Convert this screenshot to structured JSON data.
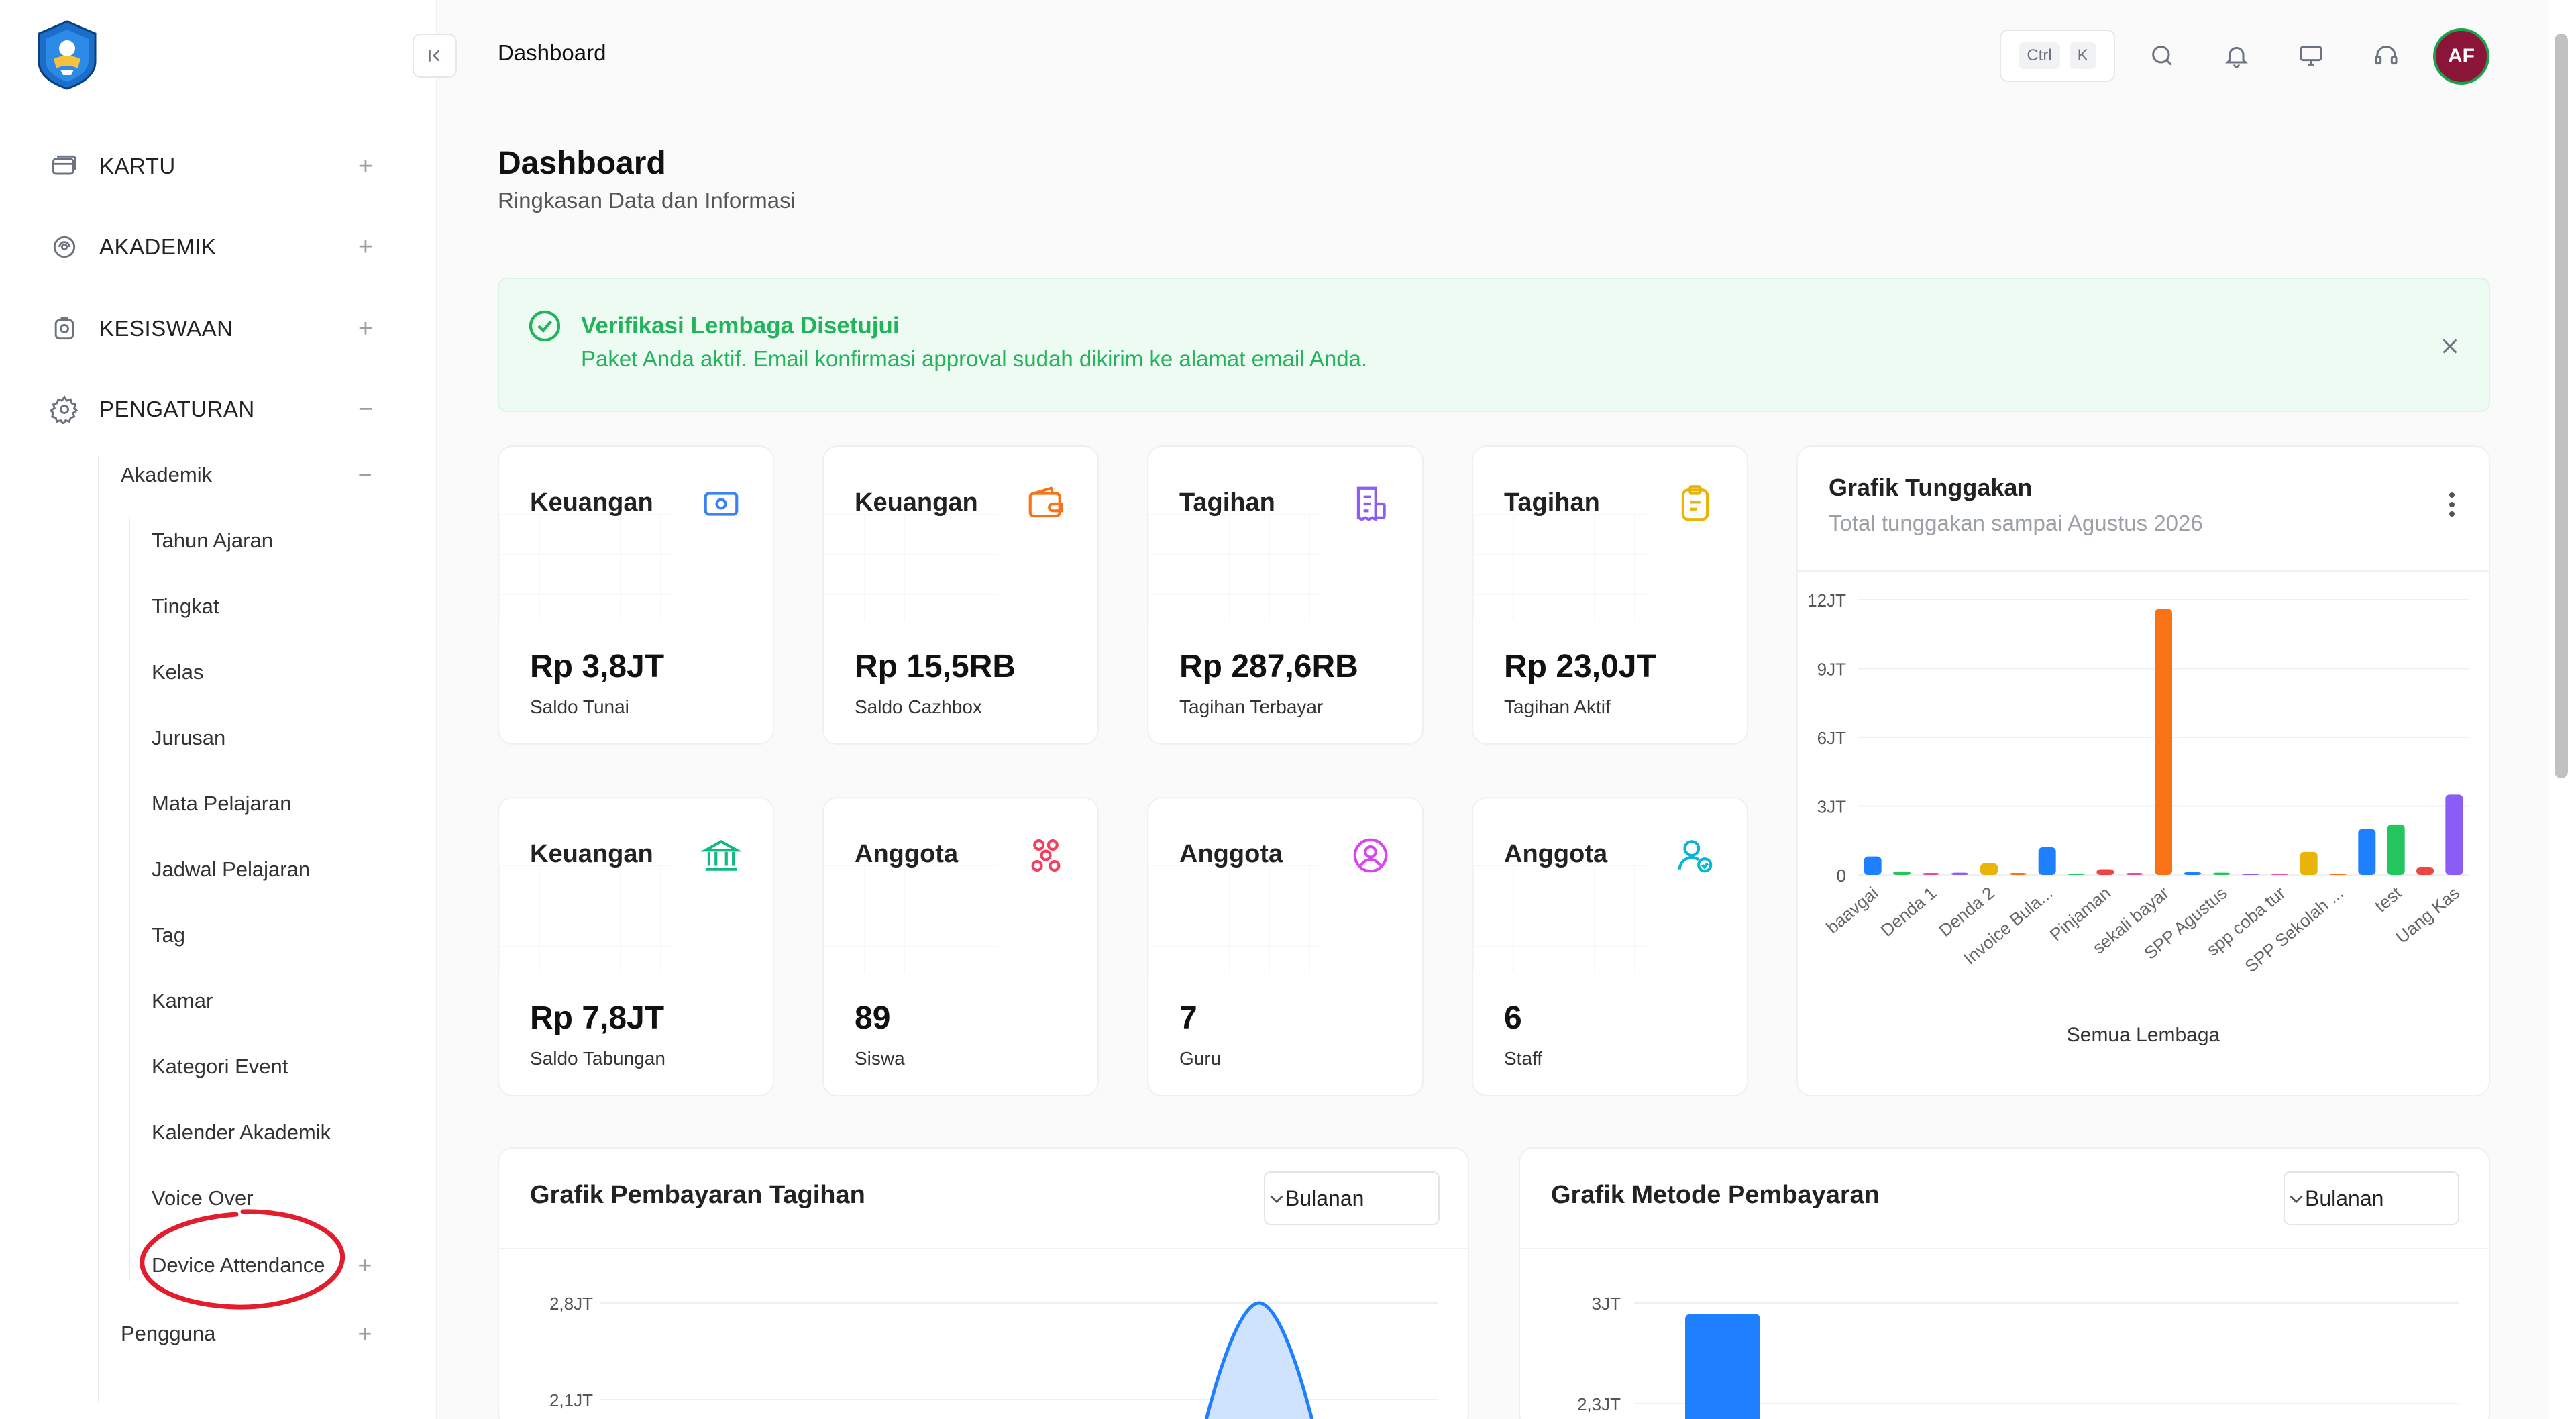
{
  "sidebar": {
    "items": [
      {
        "label": "KARTU",
        "icon": "card-icon",
        "toggle": "+"
      },
      {
        "label": "AKADEMIK",
        "icon": "academic-icon",
        "toggle": "+"
      },
      {
        "label": "KESISWAAN",
        "icon": "student-affairs-icon",
        "toggle": "+"
      },
      {
        "label": "PENGATURAN",
        "icon": "gear-icon",
        "toggle": "−"
      }
    ],
    "akademik": {
      "label": "Akademik",
      "toggle": "−"
    },
    "akademik_items": [
      "Tahun Ajaran",
      "Tingkat",
      "Kelas",
      "Jurusan",
      "Mata Pelajaran",
      "Jadwal Pelajaran",
      "Tag",
      "Kamar",
      "Kategori Event",
      "Kalender Akademik",
      "Voice Over",
      "Device Attendance"
    ],
    "device_attendance_toggle": "+",
    "pengguna": {
      "label": "Pengguna",
      "toggle": "+"
    }
  },
  "topbar": {
    "breadcrumb": "Dashboard",
    "shortcut_ctrl": "Ctrl",
    "shortcut_key": "K",
    "avatar_initials": "AF"
  },
  "page": {
    "title": "Dashboard",
    "subtitle": "Ringkasan Data dan Informasi"
  },
  "alert": {
    "title": "Verifikasi Lembaga Disetujui",
    "message": "Paket Anda aktif. Email konfirmasi approval sudah dikirim ke alamat email Anda."
  },
  "stats": [
    {
      "category": "Keuangan",
      "value": "Rp 3,8JT",
      "label": "Saldo Tunai",
      "icon": "money-icon",
      "color": "#3b82f6"
    },
    {
      "category": "Keuangan",
      "value": "Rp 15,5RB",
      "label": "Saldo Cazhbox",
      "icon": "wallet-icon",
      "color": "#f97316"
    },
    {
      "category": "Tagihan",
      "value": "Rp 287,6RB",
      "label": "Tagihan Terbayar",
      "icon": "receipt-icon",
      "color": "#8b5cf6"
    },
    {
      "category": "Tagihan",
      "value": "Rp 23,0JT",
      "label": "Tagihan Aktif",
      "icon": "clipboard-icon",
      "color": "#eab308"
    },
    {
      "category": "Keuangan",
      "value": "Rp 7,8JT",
      "label": "Saldo Tabungan",
      "icon": "bank-icon",
      "color": "#10b981"
    },
    {
      "category": "Anggota",
      "value": "89",
      "label": "Siswa",
      "icon": "group-icon",
      "color": "#f43f5e"
    },
    {
      "category": "Anggota",
      "value": "7",
      "label": "Guru",
      "icon": "user-circle-icon",
      "color": "#d946ef"
    },
    {
      "category": "Anggota",
      "value": "6",
      "label": "Staff",
      "icon": "user-check-icon",
      "color": "#06b6d4"
    }
  ],
  "arrears_chart": {
    "title": "Grafik Tunggakan",
    "subtitle": "Total tunggakan sampai Agustus 2026"
  },
  "payment_chart": {
    "title": "Grafik Pembayaran Tagihan",
    "dropdown": "Bulanan"
  },
  "method_chart": {
    "title": "Grafik Metode Pembayaran",
    "dropdown": "Bulanan"
  },
  "chart_data": [
    {
      "type": "bar",
      "title": "Grafik Tunggakan",
      "subtitle": "Total tunggakan sampai Agustus 2026",
      "xlabel": "Semua Lembaga",
      "ylabel": "",
      "ylim": [
        0,
        12
      ],
      "yticks": [
        "0",
        "3JT",
        "6JT",
        "9JT",
        "12JT"
      ],
      "grid": true,
      "categories": [
        "baavgai",
        "",
        "Denda 1",
        "",
        "Denda 2",
        "",
        "Invoice Bula...",
        "",
        "Pinjaman",
        "",
        "sekali bayar",
        "",
        "SPP Agustus",
        "",
        "spp coba tur",
        "",
        "SPP Sekolah ...",
        "",
        "test",
        "",
        "Uang Kas"
      ],
      "xtick_labels": [
        "baavgai",
        "Denda 1",
        "Denda 2",
        "Invoice Bula...",
        "Pinjaman",
        "sekali bayar",
        "SPP Agustus",
        "spp coba tur",
        "SPP Sekolah ...",
        "test",
        "Uang Kas"
      ],
      "values": [
        0.8,
        0.15,
        0.05,
        0.1,
        0.5,
        0.05,
        1.2,
        0.0,
        0.25,
        0.05,
        11.6,
        0.12,
        0.1,
        0.0,
        0.0,
        1.0,
        0.0,
        2.0,
        2.2,
        0.35,
        3.5
      ],
      "colors": [
        "#1e80ff",
        "#22c55e",
        "#ec4899",
        "#8b5cf6",
        "#eab308",
        "#f97316",
        "#1e80ff",
        "#22c55e",
        "#ef4444",
        "#ec4899",
        "#f97316",
        "#1e80ff",
        "#22c55e",
        "#8b5cf6",
        "#ec4899",
        "#eab308",
        "#f97316",
        "#1e80ff",
        "#22c55e",
        "#ef4444",
        "#8b5cf6"
      ]
    },
    {
      "type": "area",
      "title": "Grafik Pembayaran Tagihan",
      "yticks": [
        "2,8JT",
        "2,1JT"
      ],
      "ylim": [
        0,
        2.8
      ],
      "note": "partially visible"
    },
    {
      "type": "bar",
      "title": "Grafik Metode Pembayaran",
      "yticks": [
        "3JT",
        "2,3JT"
      ],
      "ylim": [
        0,
        3
      ],
      "values": [
        3
      ],
      "colors": [
        "#1e80ff"
      ]
    }
  ]
}
